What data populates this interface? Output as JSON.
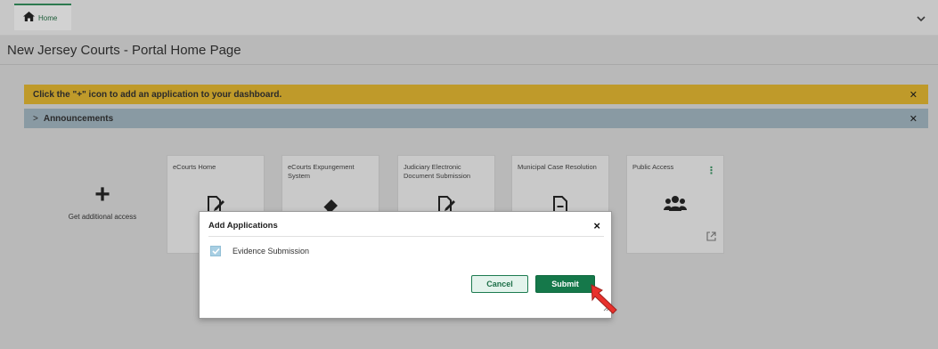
{
  "tabs": [
    {
      "label": "Home",
      "icon": "home-icon"
    }
  ],
  "header": {
    "collapse_icon": "chevron-down-icon",
    "page_title": "New Jersey Courts - Portal Home Page"
  },
  "banners": {
    "notice": "Click the \"+\" icon to add an application to your dashboard.",
    "announcements": "Announcements"
  },
  "add_tile": {
    "symbol": "+",
    "label": "Get additional access"
  },
  "cards": [
    {
      "title": "eCourts Home",
      "icon": "document-edit-icon"
    },
    {
      "title": "eCourts Expungement System",
      "icon": "eraser-icon"
    },
    {
      "title": "Judiciary Electronic Document Submission",
      "icon": "document-edit-icon"
    },
    {
      "title": "Municipal Case Resolution",
      "icon": "document-minus-icon"
    },
    {
      "title": "Public Access",
      "icon": "users-icon"
    }
  ],
  "modal": {
    "title": "Add Applications",
    "close": "×",
    "items": [
      {
        "label": "Evidence Submission",
        "checked": true
      }
    ],
    "cancel_label": "Cancel",
    "submit_label": "Submit"
  },
  "colors": {
    "accent_green": "#15784a",
    "notice_banner": "#bf9a2a",
    "announce_banner": "#899aa3"
  }
}
